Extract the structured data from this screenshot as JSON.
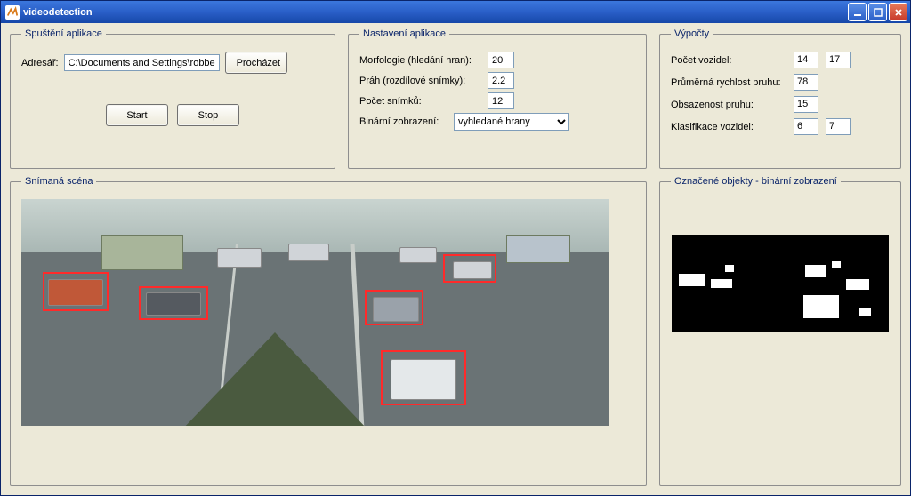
{
  "window": {
    "title": "videodetection"
  },
  "launch": {
    "legend": "Spuštění aplikace",
    "dir_label": "Adresář:",
    "dir_value": "C:\\Documents and Settings\\robber\\Dokume",
    "browse": "Procházet",
    "start": "Start",
    "stop": "Stop"
  },
  "settings": {
    "legend": "Nastavení aplikace",
    "morph_label": "Morfologie (hledání hran):",
    "morph_value": "20",
    "thresh_label": "Práh (rozdílové snímky):",
    "thresh_value": "2.2",
    "frames_label": "Počet snímků:",
    "frames_value": "12",
    "bin_label": "Binární zobrazení:",
    "bin_value": "vyhledané hrany"
  },
  "calc": {
    "legend": "Výpočty",
    "count_label": "Počet vozidel:",
    "count_a": "14",
    "count_b": "17",
    "speed_label": "Průměrná rychlost pruhu:",
    "speed": "78",
    "occ_label": "Obsazenost pruhu:",
    "occ": "15",
    "class_label": "Klasifikace vozidel:",
    "class_a": "6",
    "class_b": "7"
  },
  "scene": {
    "legend": "Snímaná scéna"
  },
  "binary": {
    "legend": "Označené objekty - binární zobrazení"
  }
}
